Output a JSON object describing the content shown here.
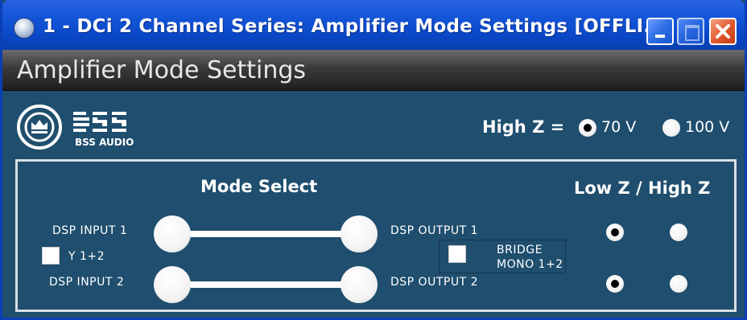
{
  "window": {
    "title": "1 - DCi 2 Channel Series: Amplifier Mode Settings [OFFLI...",
    "header": "Amplifier Mode Settings"
  },
  "logo": {
    "brand_text": "BSS AUDIO"
  },
  "high_z": {
    "label": "High Z =",
    "options": [
      {
        "label": "70 V",
        "selected": true
      },
      {
        "label": "100 V",
        "selected": false
      }
    ]
  },
  "mode_select": {
    "title": "Mode Select",
    "inputs": [
      "DSP INPUT 1",
      "DSP INPUT 2"
    ],
    "outputs": [
      "DSP OUTPUT 1",
      "DSP OUTPUT 2"
    ],
    "y_label": "Y 1+2",
    "y_checked": false,
    "bridge_label_line1": "BRIDGE",
    "bridge_label_line2": "MONO 1+2",
    "bridge_checked": false
  },
  "low_high_z": {
    "title": "Low Z / High Z",
    "channels": [
      {
        "low_selected": true,
        "high_selected": false
      },
      {
        "low_selected": true,
        "high_selected": false
      }
    ]
  },
  "colors": {
    "background": "#1f4e6e",
    "titlebar": "#0a48c8",
    "close_button": "#e0552a"
  },
  "icons": {
    "app": "app-icon",
    "minimize": "minimize-icon",
    "maximize": "maximize-icon",
    "close": "close-icon",
    "logo": "bss-audio-logo"
  }
}
